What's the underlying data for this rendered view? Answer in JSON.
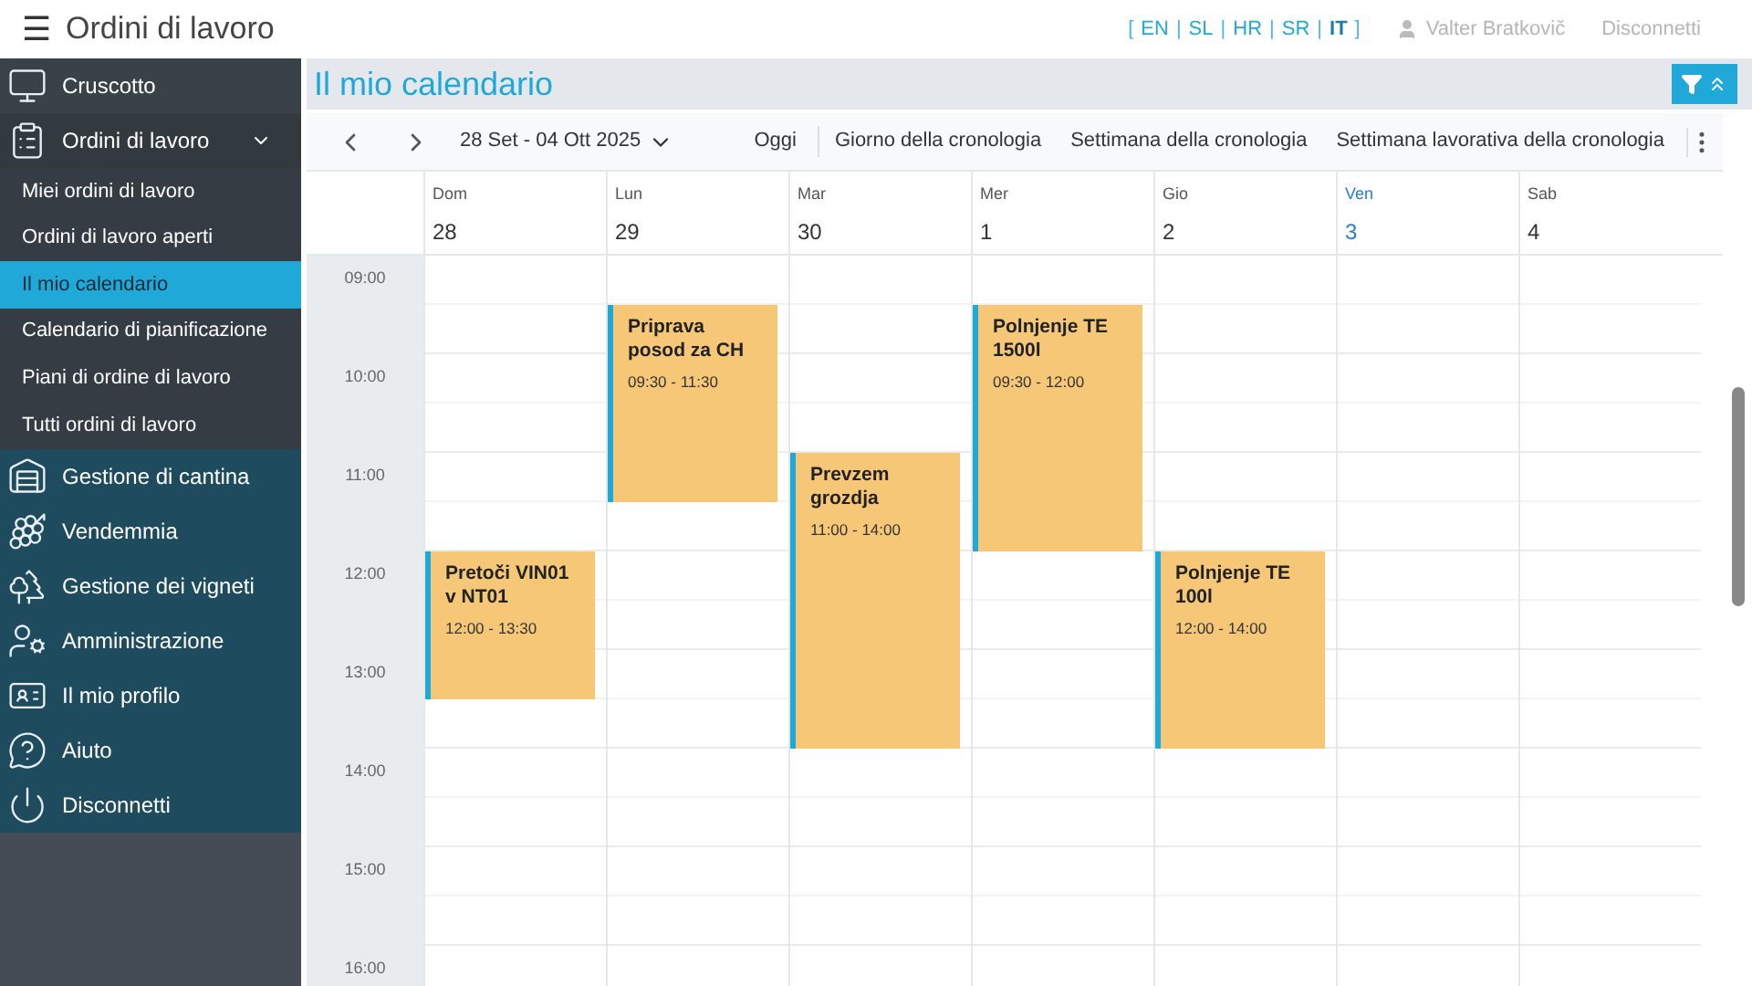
{
  "header": {
    "menu_icon": "☰",
    "title": "Ordini di lavoro",
    "language_bar": [
      {
        "kind": "bracket",
        "label": "[",
        "selected": false
      },
      {
        "kind": "language",
        "label": "EN",
        "selected": false
      },
      {
        "kind": "separator",
        "label": "|",
        "selected": false
      },
      {
        "kind": "language",
        "label": "SL",
        "selected": false
      },
      {
        "kind": "separator",
        "label": "|",
        "selected": false
      },
      {
        "kind": "language",
        "label": "HR",
        "selected": false
      },
      {
        "kind": "separator",
        "label": "|",
        "selected": false
      },
      {
        "kind": "language",
        "label": "SR",
        "selected": false
      },
      {
        "kind": "separator",
        "label": "|",
        "selected": false
      },
      {
        "kind": "language",
        "label": "IT",
        "selected": true
      },
      {
        "kind": "bracket",
        "label": "]",
        "selected": false
      }
    ],
    "user": "Valter Bratkovič",
    "logout": "Disconnetti"
  },
  "sidebar": {
    "items": [
      {
        "label": "Cruscotto"
      },
      {
        "label": "Ordini di lavoro",
        "expanded": true,
        "children": [
          {
            "label": "Miei ordini di lavoro",
            "selected": false
          },
          {
            "label": "Ordini di lavoro aperti",
            "selected": false
          },
          {
            "label": "Il mio calendario",
            "selected": true
          },
          {
            "label": "Calendario di pianificazione",
            "selected": false
          },
          {
            "label": "Piani di ordine di lavoro",
            "selected": false
          },
          {
            "label": "Tutti ordini di lavoro",
            "selected": false
          }
        ]
      },
      {
        "label": "Gestione di cantina"
      },
      {
        "label": "Vendemmia"
      },
      {
        "label": "Gestione dei vigneti"
      },
      {
        "label": "Amministrazione"
      },
      {
        "label": "Il mio profilo"
      },
      {
        "label": "Aiuto"
      },
      {
        "label": "Disconnetti"
      }
    ]
  },
  "page_title": "Il mio calendario",
  "toolbar": {
    "date_range": "28 Set - 04 Ott 2025",
    "today": "Oggi",
    "views": [
      "Giorno della cronologia",
      "Settimana della cronologia",
      "Settimana lavorativa della cronologia"
    ]
  },
  "days": [
    {
      "name": "Dom",
      "date": "28",
      "today": false,
      "events": [
        {
          "title": "Pretoči VIN01 v NT01",
          "time": "12:00 - 13:30"
        }
      ]
    },
    {
      "name": "Lun",
      "date": "29",
      "today": false,
      "events": [
        {
          "title": "Priprava posod za CH",
          "time": "09:30 - 11:30"
        }
      ]
    },
    {
      "name": "Mar",
      "date": "30",
      "today": false,
      "events": [
        {
          "title": "Prevzem grozdja",
          "time": "11:00 - 14:00"
        }
      ]
    },
    {
      "name": "Mer",
      "date": "1",
      "today": false,
      "events": [
        {
          "title": "Polnjenje TE 1500l",
          "time": "09:30 - 12:00"
        }
      ]
    },
    {
      "name": "Gio",
      "date": "2",
      "today": false,
      "events": [
        {
          "title": "Polnjenje TE 100l",
          "time": "12:00 - 14:00"
        }
      ]
    },
    {
      "name": "Ven",
      "date": "3",
      "today": true
    },
    {
      "name": "Sab",
      "date": "4",
      "today": false
    }
  ],
  "hours": [
    "09:00",
    "10:00",
    "11:00",
    "12:00",
    "13:00",
    "14:00",
    "15:00",
    "16:00"
  ]
}
